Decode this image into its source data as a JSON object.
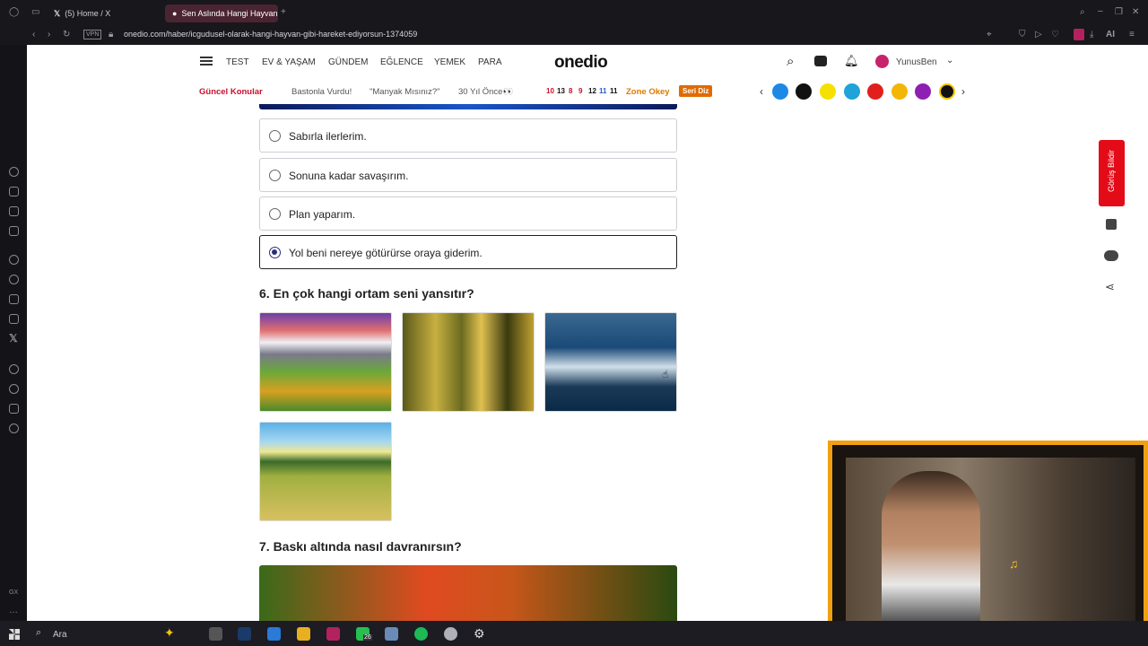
{
  "browser": {
    "tabs": [
      {
        "label": "(5) Home / X"
      },
      {
        "label": "Sen Aslında Hangi Hayvan"
      }
    ],
    "url": "onedio.com/haber/icgudusel-olarak-hangi-hayvan-gibi-hareket-ediyorsun-1374059",
    "vpn_label": "VPN",
    "ai_label": "AI",
    "sidebar_label": "GX"
  },
  "site": {
    "logo": "onedio",
    "nav": [
      "TEST",
      "EV & YAŞAM",
      "GÜNDEM",
      "EĞLENCE",
      "YEMEK",
      "PARA"
    ],
    "username": "YunusBen",
    "trending_label": "Güncel Konular",
    "trending": [
      "Bastonla Vurdu!",
      "\"Manyak Mısınız?\"",
      "30 Yıl Önce👀"
    ],
    "numbers": [
      "10",
      "13",
      "8",
      "9",
      "12",
      "11",
      "11"
    ],
    "zone_label": "Zone Okey",
    "series_label": "Seri Diz",
    "feedback_label": "Görüş Bildir"
  },
  "quiz": {
    "options_q5": [
      {
        "label": "Sabırla ilerlerim.",
        "selected": false
      },
      {
        "label": "Sonuna kadar savaşırım.",
        "selected": false
      },
      {
        "label": "Plan yaparım.",
        "selected": false
      },
      {
        "label": "Yol beni nereye götürürse oraya giderim.",
        "selected": true
      }
    ],
    "q6_title": "6. En çok hangi ortam seni yansıtır?",
    "q6_images": [
      "mountain-landscape",
      "forest",
      "ocean-waves",
      "wheat-field"
    ],
    "q7_title": "7. Baskı altında nasıl davranırsın?"
  },
  "taskbar": {
    "search_placeholder": "Ara",
    "badge": "26"
  },
  "colors": {
    "accent_red": "#e30b17",
    "selected_radio": "#2b2f7a",
    "trending_red": "#c8102e",
    "zone_orange": "#e07a00"
  }
}
